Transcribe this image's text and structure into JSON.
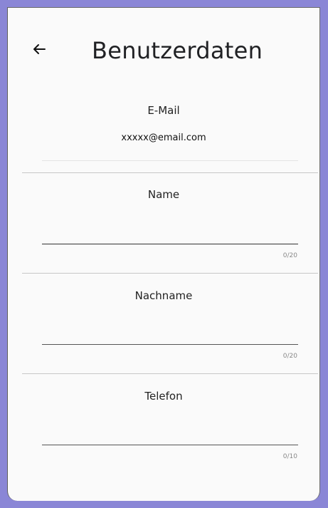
{
  "header": {
    "back_icon": "arrow-left-icon",
    "title": "Benutzerdaten"
  },
  "email": {
    "label": "E-Mail",
    "value": "xxxxx@email.com"
  },
  "fields": [
    {
      "label": "Name",
      "value": "",
      "counter": "0/20"
    },
    {
      "label": "Nachname",
      "value": "",
      "counter": "0/20"
    },
    {
      "label": "Telefon",
      "value": "",
      "counter": "0/10"
    }
  ],
  "colors": {
    "background_frame": "#8a86d6",
    "card": "#fafafa"
  }
}
